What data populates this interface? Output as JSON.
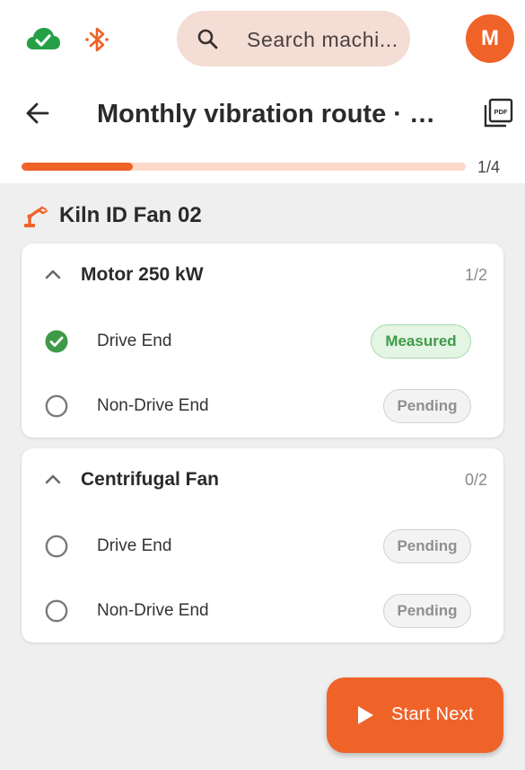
{
  "search": {
    "placeholder": "Search machi..."
  },
  "user": {
    "initial": "M"
  },
  "header": {
    "title": "Monthly vibration route · Kiln ID Fan"
  },
  "progress": {
    "current": 1,
    "total": 4,
    "label": "1/4",
    "fraction": 0.25
  },
  "machine": {
    "name": "Kiln ID Fan 02"
  },
  "components": [
    {
      "title": "Motor 250 kW",
      "count": "1/2",
      "points": [
        {
          "label": "Drive End",
          "status": "Measured",
          "state": "measured"
        },
        {
          "label": "Non-Drive End",
          "status": "Pending",
          "state": "pending"
        }
      ]
    },
    {
      "title": "Centrifugal Fan",
      "count": "0/2",
      "points": [
        {
          "label": "Drive End",
          "status": "Pending",
          "state": "pending"
        },
        {
          "label": "Non-Drive End",
          "status": "Pending",
          "state": "pending"
        }
      ]
    }
  ],
  "fab": {
    "label": "Start Next"
  },
  "colors": {
    "accent": "#ef6329",
    "accent_light": "#fcd9cb",
    "success": "#3f9a48",
    "cloud": "#25a046"
  },
  "icons": {
    "cloud": "cloud-check-icon",
    "bluetooth": "bluetooth-icon",
    "search": "search-icon",
    "back": "arrow-back-icon",
    "pdf": "pdf-icon",
    "machine": "robot-arm-icon",
    "collapse": "chevron-up-icon",
    "check": "check-circle-icon",
    "radio": "radio-unchecked-icon",
    "play": "play-icon"
  }
}
